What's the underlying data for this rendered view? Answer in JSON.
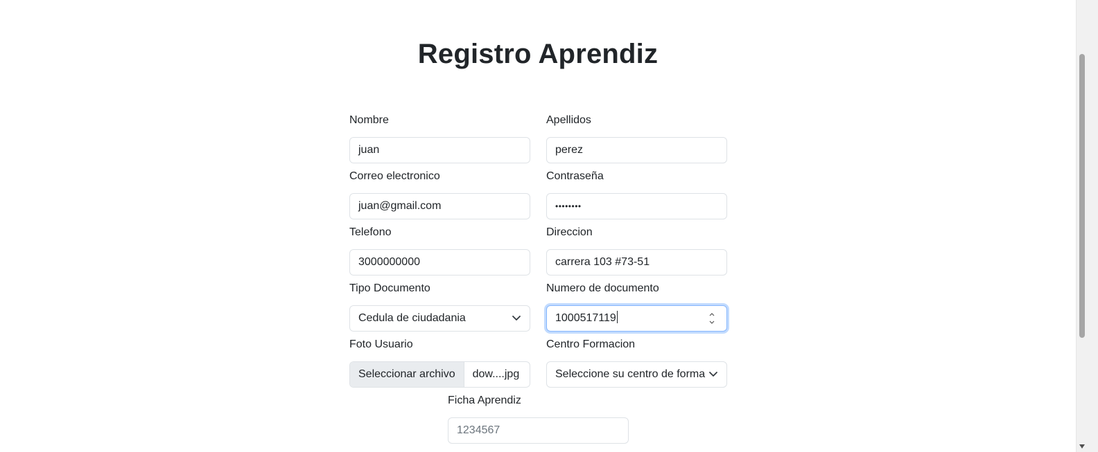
{
  "page": {
    "title": "Registro Aprendiz"
  },
  "form": {
    "nombre": {
      "label": "Nombre",
      "value": "juan"
    },
    "apellidos": {
      "label": "Apellidos",
      "value": "perez"
    },
    "correo": {
      "label": "Correo electronico",
      "value": "juan@gmail.com"
    },
    "contrasena": {
      "label": "Contraseña",
      "value": "••••••••"
    },
    "telefono": {
      "label": "Telefono",
      "value": "3000000000"
    },
    "direccion": {
      "label": "Direccion",
      "value": "carrera 103 #73-51"
    },
    "tipo_documento": {
      "label": "Tipo Documento",
      "value": "Cedula de ciudadania"
    },
    "numero_documento": {
      "label": "Numero de documento",
      "value": "1000517119"
    },
    "foto": {
      "label": "Foto Usuario",
      "button": "Seleccionar archivo",
      "filename": "dow....jpg"
    },
    "centro": {
      "label": "Centro Formacion",
      "value": "Seleccione su centro de forma"
    },
    "ficha": {
      "label": "Ficha Aprendiz",
      "placeholder": "1234567"
    }
  },
  "colors": {
    "text": "#212529",
    "border": "#dee2e6",
    "focus_border": "#86b7fe",
    "placeholder": "#6c757d",
    "file_button_bg": "#e9ecef"
  },
  "icons": {
    "select": "chevron-down-icon",
    "number": "spinner-arrows-icon",
    "scroll": "arrow-down-icon"
  }
}
